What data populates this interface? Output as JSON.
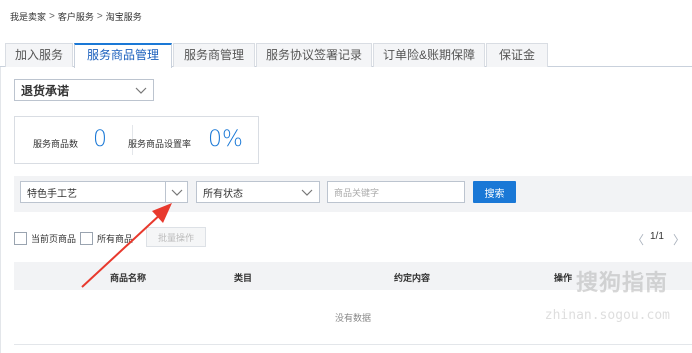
{
  "breadcrumb": {
    "items": [
      "我是卖家",
      "客户服务",
      "淘宝服务"
    ],
    "separator": ">"
  },
  "tabs": [
    {
      "label": "加入服务",
      "active": false
    },
    {
      "label": "服务商品管理",
      "active": true
    },
    {
      "label": "服务商管理",
      "active": false
    },
    {
      "label": "服务协议签署记录",
      "active": false
    },
    {
      "label": "订单险&账期保障",
      "active": false
    },
    {
      "label": "保证金",
      "active": false
    }
  ],
  "service_select": {
    "value": "退货承诺"
  },
  "stats": {
    "count_label": "服务商品数",
    "count_value": "0",
    "rate_label": "服务商品设置率",
    "rate_value": "0%"
  },
  "filters": {
    "category_value": "特色手工艺",
    "status_value": "所有状态",
    "keyword_placeholder": "商品关键字",
    "search_label": "搜索"
  },
  "list_controls": {
    "current_page_label": "当前页商品",
    "all_items_label": "所有商品",
    "batch_label": "批量操作",
    "pager_text": "1/1",
    "prev_arrow": "〈",
    "next_arrow": "〉"
  },
  "table": {
    "columns": [
      "商品名称",
      "类目",
      "约定内容",
      "操作"
    ],
    "empty_text": "没有数据"
  },
  "watermark": {
    "brand": "搜狗指南",
    "url": "zhinan.sogou.com"
  },
  "colors": {
    "accent": "#1a78d6",
    "annotation_arrow": "#e8392d"
  }
}
